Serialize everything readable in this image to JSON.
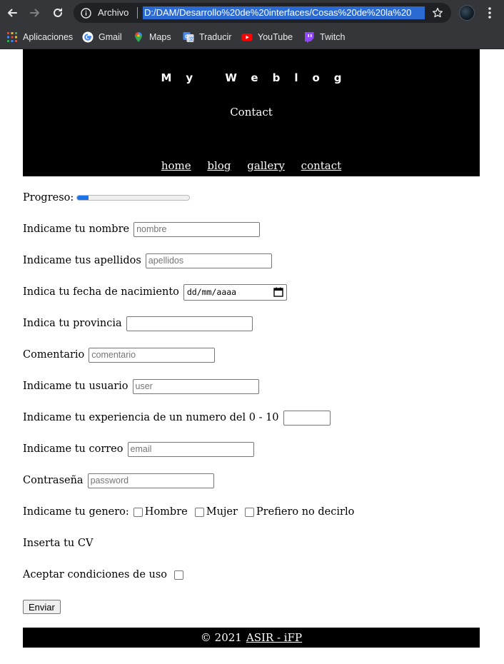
{
  "browser": {
    "scheme_label": "Archivo",
    "url": "D:/DAM/Desarrollo%20de%20interfaces/Cosas%20de%20la%20",
    "bookmarks": [
      {
        "label": "Aplicaciones",
        "icon": "apps-grid-icon"
      },
      {
        "label": "Gmail",
        "icon": "google-icon"
      },
      {
        "label": "Maps",
        "icon": "maps-pin-icon"
      },
      {
        "label": "Traducir",
        "icon": "translate-icon"
      },
      {
        "label": "YouTube",
        "icon": "youtube-icon"
      },
      {
        "label": "Twitch",
        "icon": "twitch-icon"
      }
    ]
  },
  "header": {
    "brand": "My Weblog",
    "subtitle": "Contact",
    "nav": [
      "home",
      "blog",
      "gallery",
      "contact"
    ]
  },
  "form": {
    "progress_label": "Progreso:",
    "progress_value": 0.1,
    "nombre_label": "Indicame tu nombre",
    "nombre_placeholder": "nombre",
    "apellidos_label": "Indicame tus apellidos",
    "apellidos_placeholder": "apellidos",
    "fecha_label": "Indica tu fecha de nacimiento",
    "fecha_placeholder": "dd/mm/aaaa",
    "provincia_label": "Indica tu provincia",
    "comentario_label": "Comentario",
    "comentario_placeholder": "comentario",
    "usuario_label": "Indicame tu usuario",
    "usuario_placeholder": "user",
    "experiencia_label": "Indicame tu experiencia de un numero del 0 - 10",
    "correo_label": "Indicame tu correo",
    "correo_placeholder": "email",
    "password_label": "Contraseña",
    "password_placeholder": "password",
    "genero_label": "Indicame tu genero:",
    "genero_options": [
      "Hombre",
      "Mujer",
      "Prefiero no decirlo"
    ],
    "cv_label": "Inserta tu CV",
    "condiciones_label": "Aceptar condiciones de uso",
    "submit_label": "Enviar"
  },
  "footer": {
    "copyright": "© 2021",
    "link": "ASIR - iFP"
  },
  "colors": {
    "chrome_bg": "#35363a",
    "url_highlight": "#2a6ad2",
    "header_bg": "#000000",
    "progress_fill": "#1a73e8"
  }
}
